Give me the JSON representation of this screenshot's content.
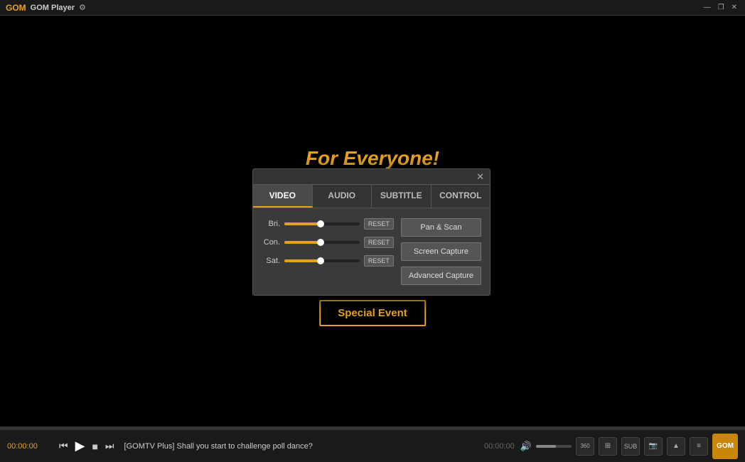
{
  "titlebar": {
    "title": "GOM Player",
    "gear_icon": "⚙",
    "min_btn": "—",
    "restore_btn": "❐",
    "close_btn": "✕"
  },
  "video": {
    "promo_text": "For Everyone!",
    "special_event_label": "Special Event"
  },
  "dialog": {
    "close_icon": "✕",
    "tabs": [
      {
        "id": "video",
        "label": "VIDEO",
        "active": true
      },
      {
        "id": "audio",
        "label": "AUDIO",
        "active": false
      },
      {
        "id": "subtitle",
        "label": "SUBTITLE",
        "active": false
      },
      {
        "id": "control",
        "label": "CONTROL",
        "active": false
      }
    ],
    "sliders": [
      {
        "id": "bri",
        "label": "Bri.",
        "value": 50,
        "fill_pct": 48
      },
      {
        "id": "con",
        "label": "Con.",
        "value": 50,
        "fill_pct": 48
      },
      {
        "id": "sat",
        "label": "Sat.",
        "value": 50,
        "fill_pct": 48
      }
    ],
    "reset_label": "RESET",
    "buttons": [
      {
        "id": "pan-scan",
        "label": "Pan & Scan"
      },
      {
        "id": "screen-capture",
        "label": "Screen Capture"
      },
      {
        "id": "advanced-capture",
        "label": "Advanced Capture"
      }
    ]
  },
  "controlbar": {
    "time_left": "00:00:00",
    "time_right": "00:00:00",
    "song_title": "[GOMTV Plus] Shall you start to challenge poll dance?",
    "play_icon": "▶",
    "stop_icon": "■",
    "prev_icon": "⏮",
    "next_icon": "⏭",
    "volume_icon": "🔊",
    "right_buttons": [
      "360",
      "⊞",
      "SUB",
      "📷",
      "▲",
      "≡"
    ],
    "gom_logo": "GOM"
  }
}
